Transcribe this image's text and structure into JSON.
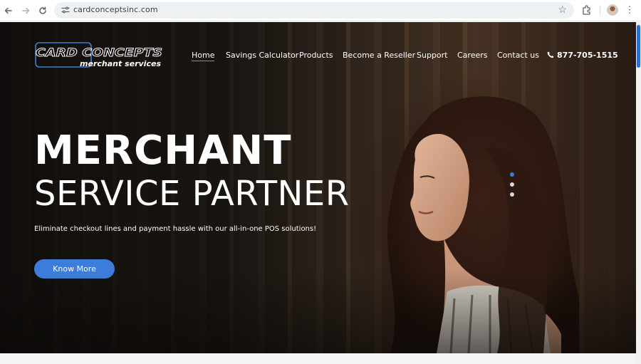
{
  "browser": {
    "url": "cardconceptsinc.com",
    "icons": [
      "back-icon",
      "forward-icon",
      "reload-icon",
      "site-settings-icon",
      "star-icon",
      "extensions-icon",
      "profile-avatar",
      "kebab-menu-icon"
    ]
  },
  "site": {
    "logo": {
      "line1": "CARD CONCEPTS",
      "line2": "merchant services"
    },
    "nav": [
      {
        "label": "Home",
        "active": true
      },
      {
        "label": "Savings Calculator",
        "active": false
      },
      {
        "label": "Products",
        "active": false
      },
      {
        "label": "Become a Reseller",
        "active": false
      },
      {
        "label": "Support",
        "active": false
      },
      {
        "label": "Careers",
        "active": false
      },
      {
        "label": "Contact us",
        "active": false
      }
    ],
    "phone": "877-705-1515"
  },
  "hero": {
    "headline_line1": "MERCHANT",
    "headline_line2": "SERVICE PARTNER",
    "subtext": "Eliminate checkout lines and payment hassle with our all-in-one POS solutions!",
    "cta_label": "Know More",
    "slides_total": 3,
    "slide_active": 1
  },
  "colors": {
    "accent": "#3b7dd8",
    "nav_text": "#ffffff",
    "active_underline": "#3aa0ff",
    "scroll_thumb": "#2b6fd6"
  }
}
